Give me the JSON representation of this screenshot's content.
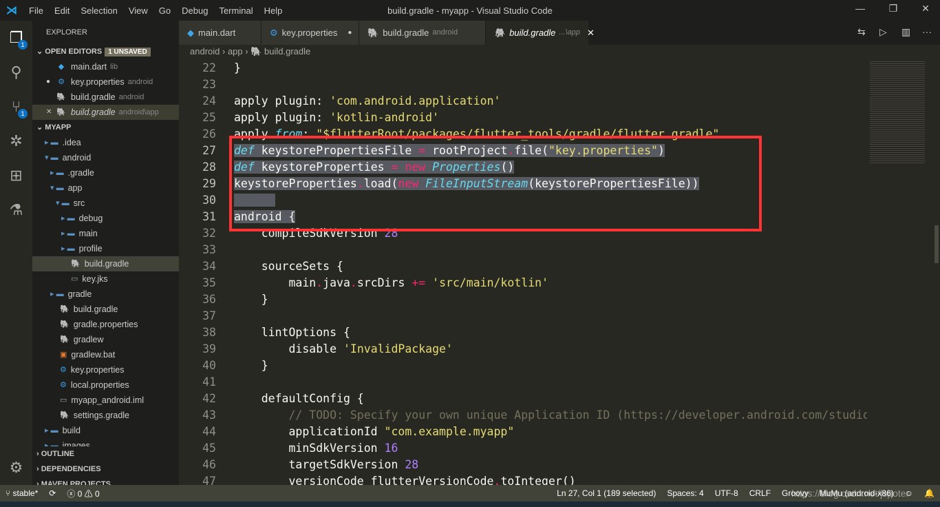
{
  "window": {
    "title": "build.gradle - myapp - Visual Studio Code"
  },
  "menu": [
    "File",
    "Edit",
    "Selection",
    "View",
    "Go",
    "Debug",
    "Terminal",
    "Help"
  ],
  "activity": {
    "explorer_badge": "1",
    "scm_badge": "1"
  },
  "sidebar": {
    "header": "EXPLORER",
    "open_editors": "OPEN EDITORS",
    "unsaved": "1 UNSAVED",
    "editors": [
      {
        "name": "main.dart",
        "desc": "lib",
        "icon": "dart-icon"
      },
      {
        "name": "key.properties",
        "desc": "android",
        "icon": "gear-icon",
        "dirty": true
      },
      {
        "name": "build.gradle",
        "desc": "android",
        "icon": "gradle-icon"
      },
      {
        "name": "build.gradle",
        "desc": "android\\app",
        "icon": "gradle-icon",
        "active": true
      }
    ],
    "project": "MYAPP",
    "tree": [
      {
        "name": ".idea",
        "depth": 1,
        "type": "folder"
      },
      {
        "name": "android",
        "depth": 1,
        "type": "folder-open"
      },
      {
        "name": ".gradle",
        "depth": 2,
        "type": "folder"
      },
      {
        "name": "app",
        "depth": 2,
        "type": "folder-open"
      },
      {
        "name": "src",
        "depth": 3,
        "type": "folder-open"
      },
      {
        "name": "debug",
        "depth": 4,
        "type": "folder"
      },
      {
        "name": "main",
        "depth": 4,
        "type": "folder"
      },
      {
        "name": "profile",
        "depth": 4,
        "type": "folder"
      },
      {
        "name": "build.gradle",
        "depth": 4,
        "type": "gradle",
        "selected": true
      },
      {
        "name": "key.jks",
        "depth": 4,
        "type": "file"
      },
      {
        "name": "gradle",
        "depth": 2,
        "type": "folder"
      },
      {
        "name": "build.gradle",
        "depth": 2,
        "type": "gradle"
      },
      {
        "name": "gradle.properties",
        "depth": 2,
        "type": "gradle"
      },
      {
        "name": "gradlew",
        "depth": 2,
        "type": "gradle"
      },
      {
        "name": "gradlew.bat",
        "depth": 2,
        "type": "bat"
      },
      {
        "name": "key.properties",
        "depth": 2,
        "type": "gear"
      },
      {
        "name": "local.properties",
        "depth": 2,
        "type": "gear"
      },
      {
        "name": "myapp_android.iml",
        "depth": 2,
        "type": "file"
      },
      {
        "name": "settings.gradle",
        "depth": 2,
        "type": "gradle"
      },
      {
        "name": "build",
        "depth": 1,
        "type": "folder"
      },
      {
        "name": "images",
        "depth": 1,
        "type": "folder"
      }
    ],
    "sections": [
      "OUTLINE",
      "DEPENDENCIES",
      "MAVEN PROJECTS"
    ]
  },
  "tabs": [
    {
      "name": "main.dart",
      "desc": ""
    },
    {
      "name": "key.properties",
      "desc": "",
      "dirty": true
    },
    {
      "name": "build.gradle",
      "desc": "android"
    },
    {
      "name": "build.gradle",
      "desc": "...\\app",
      "active": true
    }
  ],
  "breadcrumb": [
    "android",
    "app",
    "build.gradle"
  ],
  "code": [
    {
      "n": "22",
      "t": [
        [
          "}",
          "p"
        ]
      ]
    },
    {
      "n": "23",
      "t": []
    },
    {
      "n": "24",
      "t": [
        [
          "apply plugin",
          "p"
        ],
        [
          ": ",
          "p"
        ],
        [
          "'com.android.application'",
          "s"
        ]
      ]
    },
    {
      "n": "25",
      "t": [
        [
          "apply plugin",
          "p"
        ],
        [
          ": ",
          "p"
        ],
        [
          "'kotlin-android'",
          "s"
        ]
      ]
    },
    {
      "n": "26",
      "t": [
        [
          "apply ",
          "p"
        ],
        [
          "from",
          "k"
        ],
        [
          ": ",
          "p"
        ],
        [
          "\"$flutterRoot/packages/flutter_tools/gradle/flutter.gradle\"",
          "s"
        ]
      ]
    },
    {
      "n": "27",
      "hl": true,
      "t": [
        [
          "def",
          "k"
        ],
        [
          " keystorePropertiesFile ",
          "p"
        ],
        [
          "=",
          "o"
        ],
        [
          " rootProject",
          "p"
        ],
        [
          ".",
          "o"
        ],
        [
          "file(",
          "p"
        ],
        [
          "\"key.properties\"",
          "s"
        ],
        [
          ")",
          "p"
        ]
      ]
    },
    {
      "n": "28",
      "hl": true,
      "t": [
        [
          "def",
          "k"
        ],
        [
          " keystoreProperties ",
          "p"
        ],
        [
          "=",
          "o"
        ],
        [
          " ",
          "p"
        ],
        [
          "new",
          "o"
        ],
        [
          " ",
          "p"
        ],
        [
          "Properties",
          "t"
        ],
        [
          "()",
          "p"
        ]
      ]
    },
    {
      "n": "29",
      "hl": true,
      "t": [
        [
          "keystoreProperties",
          "p"
        ],
        [
          ".",
          "o"
        ],
        [
          "load(",
          "p"
        ],
        [
          "new",
          "o"
        ],
        [
          " ",
          "p"
        ],
        [
          "FileInputStream",
          "t"
        ],
        [
          "(keystorePropertiesFile))",
          "p"
        ]
      ]
    },
    {
      "n": "30",
      "hl": true,
      "t": [
        [
          "      ",
          "p"
        ]
      ]
    },
    {
      "n": "31",
      "hl": true,
      "t": [
        [
          "android {",
          "p"
        ]
      ]
    },
    {
      "n": "32",
      "t": [
        [
          "    compileSdkVersion ",
          "p"
        ],
        [
          "28",
          "n"
        ]
      ]
    },
    {
      "n": "33",
      "t": []
    },
    {
      "n": "34",
      "t": [
        [
          "    sourceSets {",
          "p"
        ]
      ]
    },
    {
      "n": "35",
      "t": [
        [
          "        main",
          "p"
        ],
        [
          ".",
          "o"
        ],
        [
          "java",
          "p"
        ],
        [
          ".",
          "o"
        ],
        [
          "srcDirs ",
          "p"
        ],
        [
          "+=",
          "o"
        ],
        [
          " ",
          "p"
        ],
        [
          "'src/main/kotlin'",
          "s"
        ]
      ]
    },
    {
      "n": "36",
      "t": [
        [
          "    }",
          "p"
        ]
      ]
    },
    {
      "n": "37",
      "t": []
    },
    {
      "n": "38",
      "t": [
        [
          "    lintOptions {",
          "p"
        ]
      ]
    },
    {
      "n": "39",
      "t": [
        [
          "        disable ",
          "p"
        ],
        [
          "'InvalidPackage'",
          "s"
        ]
      ]
    },
    {
      "n": "40",
      "t": [
        [
          "    }",
          "p"
        ]
      ]
    },
    {
      "n": "41",
      "t": []
    },
    {
      "n": "42",
      "t": [
        [
          "    defaultConfig {",
          "p"
        ]
      ]
    },
    {
      "n": "43",
      "t": [
        [
          "        // TODO: Specify your own unique Application ID (https://developer.android.com/studio",
          "c"
        ]
      ]
    },
    {
      "n": "44",
      "t": [
        [
          "        applicationId ",
          "p"
        ],
        [
          "\"com.example.myapp\"",
          "s"
        ]
      ]
    },
    {
      "n": "45",
      "t": [
        [
          "        minSdkVersion ",
          "p"
        ],
        [
          "16",
          "n"
        ]
      ]
    },
    {
      "n": "46",
      "t": [
        [
          "        targetSdkVersion ",
          "p"
        ],
        [
          "28",
          "n"
        ]
      ]
    },
    {
      "n": "47",
      "t": [
        [
          "        versionCode flutterVersionCode",
          "p"
        ],
        [
          ".",
          "o"
        ],
        [
          "toInteger()",
          "p"
        ]
      ]
    }
  ],
  "status": {
    "branch": "stable*",
    "errors": "0",
    "warnings": "0",
    "position": "Ln 27, Col 1 (189 selected)",
    "spaces": "Spaces: 4",
    "encoding": "UTF-8",
    "eol": "CRLF",
    "language": "Groovy",
    "device": "MuMu (android-x86)",
    "watermark": "https://blog.csdn.net/jspoter"
  }
}
